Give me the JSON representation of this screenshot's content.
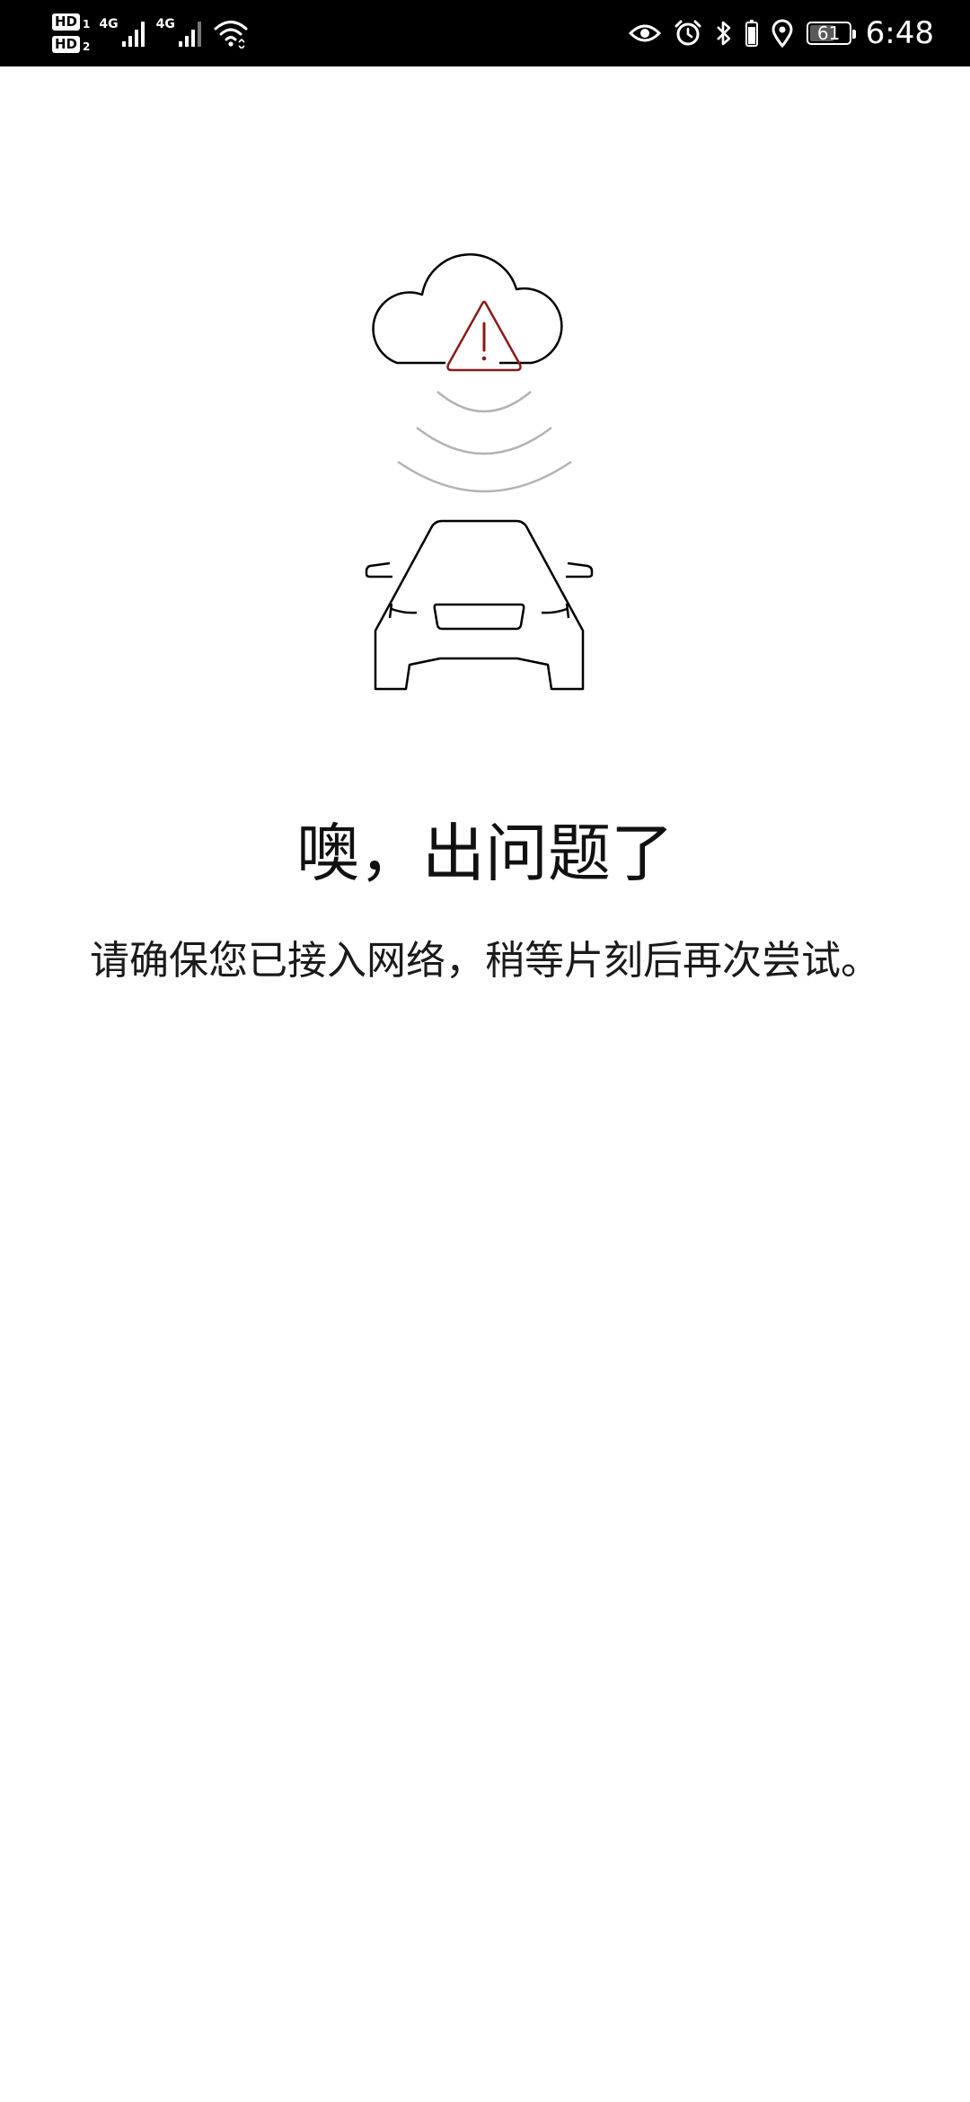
{
  "status_bar": {
    "sim1_label": "HD",
    "sim1_index": "1",
    "sim2_label": "HD",
    "sim2_index": "2",
    "network1": "4G",
    "network2": "4G",
    "battery_level": 61,
    "battery_text": "61",
    "time": "6:48",
    "icons": [
      "eye-comfort-icon",
      "alarm-icon",
      "bluetooth-icon",
      "location-icon",
      "wifi-icon",
      "signal-icon"
    ]
  },
  "error": {
    "title": "噢，出问题了",
    "message": "请确保您已接入网络，稍等片刻后再次尝试。"
  },
  "colors": {
    "warning": "#8B1A14",
    "line": "#000000",
    "waves": "#b3b3b3"
  }
}
